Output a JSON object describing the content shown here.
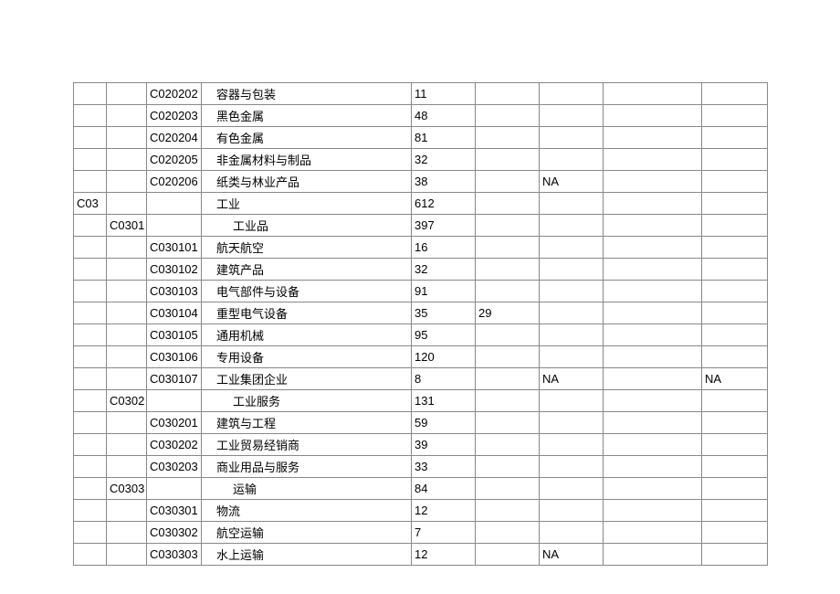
{
  "rows": [
    {
      "c1": "",
      "c2": "",
      "c3": "C020202",
      "c4": "容器与包装",
      "c4class": "indent3",
      "c5": "11",
      "c6": "",
      "c7": "",
      "c8": "",
      "c9": ""
    },
    {
      "c1": "",
      "c2": "",
      "c3": "C020203",
      "c4": "黑色金属",
      "c4class": "indent3",
      "c5": "48",
      "c6": "",
      "c7": "",
      "c8": "",
      "c9": ""
    },
    {
      "c1": "",
      "c2": "",
      "c3": "C020204",
      "c4": "有色金属",
      "c4class": "indent3",
      "c5": "81",
      "c6": "",
      "c7": "",
      "c8": "",
      "c9": ""
    },
    {
      "c1": "",
      "c2": "",
      "c3": "C020205",
      "c4": "非金属材料与制品",
      "c4class": "indent3",
      "c5": "32",
      "c6": "",
      "c7": "",
      "c8": "",
      "c9": ""
    },
    {
      "c1": "",
      "c2": "",
      "c3": "C020206",
      "c4": "纸类与林业产品",
      "c4class": "indent3",
      "c5": "38",
      "c6": "",
      "c7": "NA",
      "c8": "",
      "c9": ""
    },
    {
      "c1": "C03",
      "c2": "",
      "c3": "",
      "c4": "工业",
      "c4class": "indent1",
      "c5": "612",
      "c6": "",
      "c7": "",
      "c8": "",
      "c9": ""
    },
    {
      "c1": "",
      "c2": "C0301",
      "c3": "",
      "c4": "工业品",
      "c4class": "indent2",
      "c5": "397",
      "c6": "",
      "c7": "",
      "c8": "",
      "c9": ""
    },
    {
      "c1": "",
      "c2": "",
      "c3": "C030101",
      "c4": "航天航空",
      "c4class": "indent3",
      "c5": "16",
      "c6": "",
      "c7": "",
      "c8": "",
      "c9": ""
    },
    {
      "c1": "",
      "c2": "",
      "c3": "C030102",
      "c4": "建筑产品",
      "c4class": "indent3",
      "c5": "32",
      "c6": "",
      "c7": "",
      "c8": "",
      "c9": ""
    },
    {
      "c1": "",
      "c2": "",
      "c3": "C030103",
      "c4": "电气部件与设备",
      "c4class": "indent3",
      "c5": "91",
      "c6": "",
      "c7": "",
      "c8": "",
      "c9": ""
    },
    {
      "c1": "",
      "c2": "",
      "c3": "C030104",
      "c4": "重型电气设备",
      "c4class": "indent3",
      "c5": "35",
      "c6": "29",
      "c7": "",
      "c8": "",
      "c9": ""
    },
    {
      "c1": "",
      "c2": "",
      "c3": "C030105",
      "c4": "通用机械",
      "c4class": "indent3",
      "c5": "95",
      "c6": "",
      "c7": "",
      "c8": "",
      "c9": ""
    },
    {
      "c1": "",
      "c2": "",
      "c3": "C030106",
      "c4": "专用设备",
      "c4class": "indent3",
      "c5": "120",
      "c6": "",
      "c7": "",
      "c8": "",
      "c9": ""
    },
    {
      "c1": "",
      "c2": "",
      "c3": "C030107",
      "c4": "工业集团企业",
      "c4class": "indent3",
      "c5": "8",
      "c6": "",
      "c7": "NA",
      "c8": "",
      "c9": "NA"
    },
    {
      "c1": "",
      "c2": "C0302",
      "c3": "",
      "c4": "工业服务",
      "c4class": "indent2",
      "c5": "131",
      "c6": "",
      "c7": "",
      "c8": "",
      "c9": ""
    },
    {
      "c1": "",
      "c2": "",
      "c3": "C030201",
      "c4": "建筑与工程",
      "c4class": "indent3",
      "c5": "59",
      "c6": "",
      "c7": "",
      "c8": "",
      "c9": ""
    },
    {
      "c1": "",
      "c2": "",
      "c3": "C030202",
      "c4": "工业贸易经销商",
      "c4class": "indent3",
      "c5": "39",
      "c6": "",
      "c7": "",
      "c8": "",
      "c9": ""
    },
    {
      "c1": "",
      "c2": "",
      "c3": "C030203",
      "c4": "商业用品与服务",
      "c4class": "indent3",
      "c5": "33",
      "c6": "",
      "c7": "",
      "c8": "",
      "c9": ""
    },
    {
      "c1": "",
      "c2": "C0303",
      "c3": "",
      "c4": "运输",
      "c4class": "indent2",
      "c5": "84",
      "c6": "",
      "c7": "",
      "c8": "",
      "c9": ""
    },
    {
      "c1": "",
      "c2": "",
      "c3": "C030301",
      "c4": "物流",
      "c4class": "indent3",
      "c5": "12",
      "c6": "",
      "c7": "",
      "c8": "",
      "c9": ""
    },
    {
      "c1": "",
      "c2": "",
      "c3": "C030302",
      "c4": "航空运输",
      "c4class": "indent3",
      "c5": "7",
      "c6": "",
      "c7": "",
      "c8": "",
      "c9": ""
    },
    {
      "c1": "",
      "c2": "",
      "c3": "C030303",
      "c4": "水上运输",
      "c4class": "indent3",
      "c5": "12",
      "c6": "",
      "c7": "NA",
      "c8": "",
      "c9": ""
    }
  ]
}
